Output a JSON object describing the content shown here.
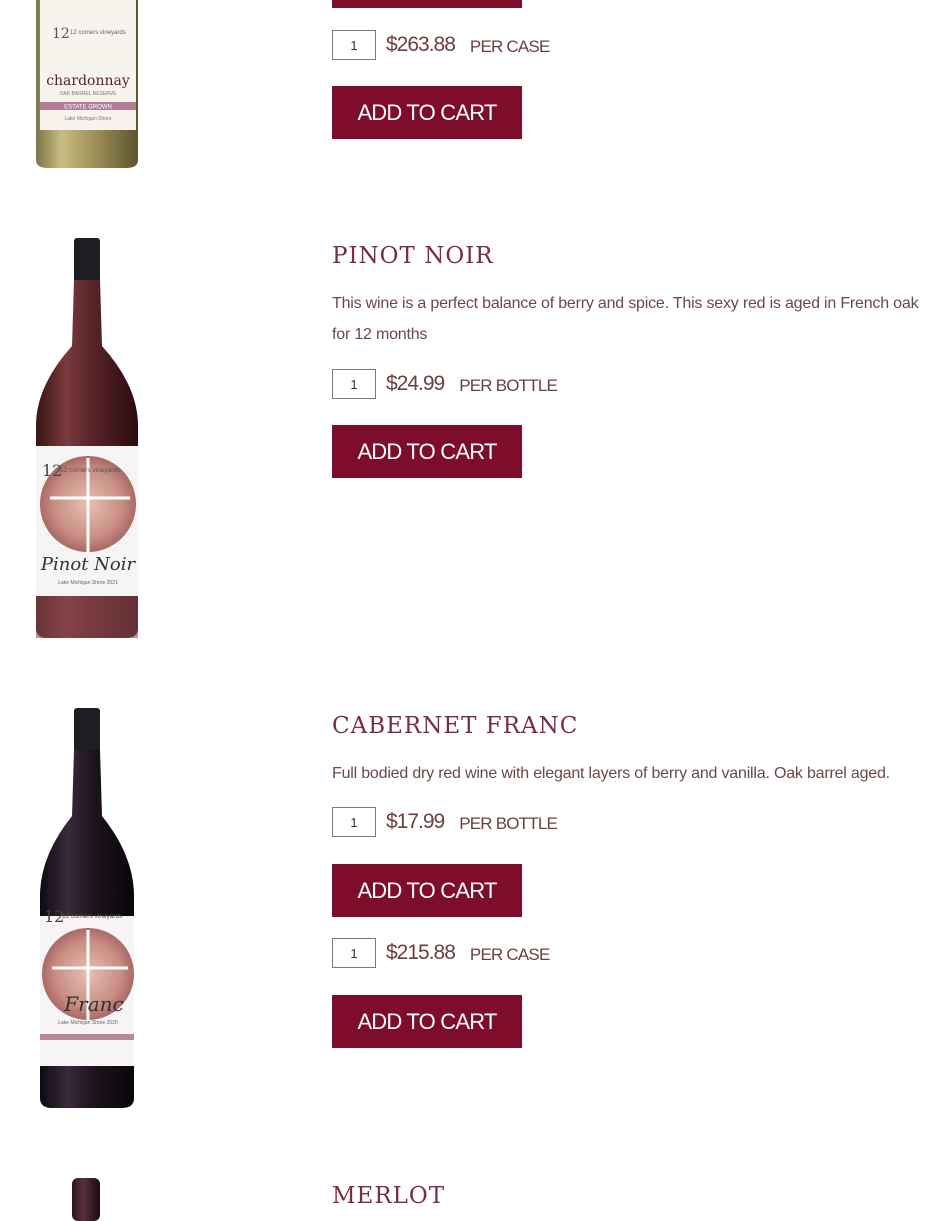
{
  "products": [
    {
      "name": "",
      "label_brand": "12 corners vineyards",
      "label_wine": "chardonnay",
      "label_sub": "OAK BARREL RESERVE",
      "label_band": "ESTATE GROWN",
      "label_region": "Lake Michigan Shore",
      "offers": [
        {
          "qty": "1",
          "price": "$263.88",
          "unit": "PER CASE",
          "button": "ADD TO CART"
        }
      ]
    },
    {
      "name": "PINOT NOIR",
      "description": "This wine is a perfect balance of berry and spice. This sexy red is aged in French oak for 12 months",
      "label_brand": "12 corners vineyards",
      "label_wine": "Pinot Noir",
      "label_region": "Lake Michigan Shore 2021",
      "offers": [
        {
          "qty": "1",
          "price": "$24.99",
          "unit": "PER BOTTLE",
          "button": "ADD TO CART"
        }
      ]
    },
    {
      "name": "CABERNET FRANC",
      "description": "Full bodied dry red wine with elegant layers of berry and vanilla. Oak barrel aged.",
      "label_brand": "12 corners vineyards",
      "label_wine": "Franc",
      "label_region": "Lake Michigan Shore 2020",
      "offers": [
        {
          "qty": "1",
          "price": "$17.99",
          "unit": "PER BOTTLE",
          "button": "ADD TO CART"
        },
        {
          "qty": "1",
          "price": "$215.88",
          "unit": "PER CASE",
          "button": "ADD TO CART"
        }
      ]
    },
    {
      "name": "MERLOT"
    }
  ],
  "colors": {
    "button_bg": "#7e0d2b",
    "heading": "#7a2d3e",
    "text": "#6b4848"
  }
}
